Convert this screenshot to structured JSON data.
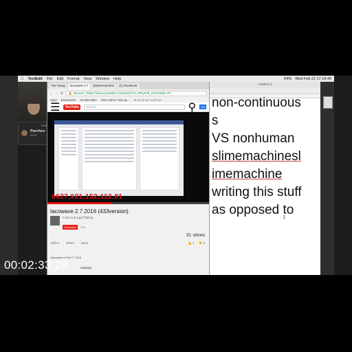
{
  "menubar": {
    "app": "TextEdit",
    "items": [
      "File",
      "Edit",
      "Format",
      "View",
      "Window",
      "Help"
    ],
    "clock": "Wed Feb 22  17:18:40",
    "battery": "84%"
  },
  "call": {
    "title": "Current Call",
    "name": "Parches",
    "time": "00:57"
  },
  "browser": {
    "tabs": [
      "Tim Toang",
      "tacowave 2.7",
      "(5)limemachine",
      "(1) Facebook"
    ],
    "secure_label": "Secure",
    "url": "https://www.youtube.com/watch?v=PPyrH8_eZVA&list=PL",
    "bookmarks": [
      "Apps",
      "Bookmarks",
      "SimpleAdder",
      "Rare Aphex Twin ge...",
      "m o n k • p r o p h e t"
    ],
    "yt_logo": "YouTube",
    "search_placeholder": "Search",
    "upload_label": "Up",
    "video_overlay_text": "6627,921,152,112.81",
    "video_title": "tacowave 2.7.2016 (433version)",
    "channel_name": "t i m t o a n g // 718 co.",
    "subscribe_label": "Subscribe",
    "sub_count": "372",
    "views": "31 views",
    "actions": [
      "Add to",
      "Share",
      "More"
    ],
    "likes": "1",
    "dislikes": "0",
    "uploaded": "Uploaded on Feb 7, 2016",
    "version_text": "version)"
  },
  "textedit": {
    "title": "Untitled 2",
    "lines": [
      "non-continuous",
      "s",
      "VS nonhuman",
      "slimemachinesl",
      "imemachine",
      "writing this stuff",
      "as opposed to"
    ]
  },
  "timecode": "00:02:33;29"
}
